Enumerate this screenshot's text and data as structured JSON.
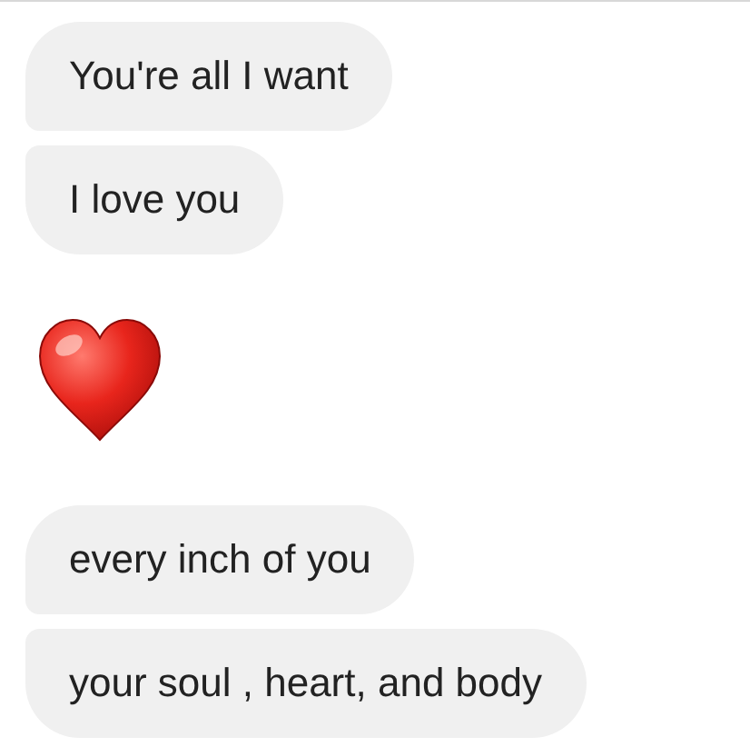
{
  "messages": [
    {
      "kind": "text",
      "text": "You're all I want"
    },
    {
      "kind": "text",
      "text": "I love you"
    },
    {
      "kind": "heart"
    },
    {
      "kind": "text",
      "text": "every inch of you"
    },
    {
      "kind": "text",
      "text": "your soul , heart, and body"
    }
  ]
}
